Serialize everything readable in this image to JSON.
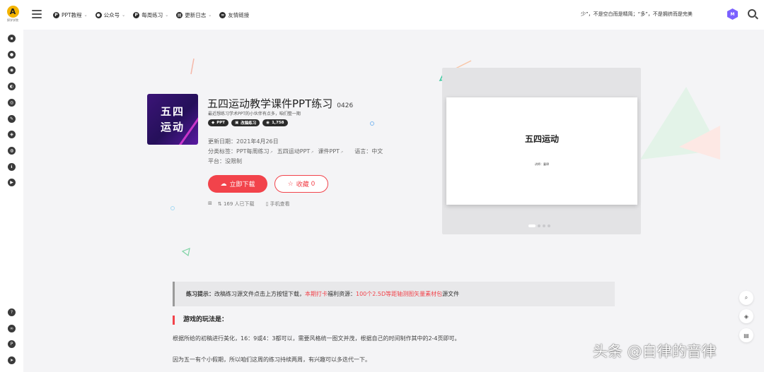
{
  "header": {
    "logo_mark": "A",
    "logo_text": "探学学院",
    "nav": [
      {
        "label": "PPT教程",
        "icon": "P",
        "icon_name": "ppt-icon",
        "has_caret": true
      },
      {
        "label": "公众号",
        "icon": "●",
        "icon_name": "wechat-icon",
        "has_caret": true
      },
      {
        "label": "每周练习",
        "icon": "P",
        "icon_name": "practice-icon",
        "has_caret": true
      },
      {
        "label": "更新日志",
        "icon": "▤",
        "icon_name": "log-icon",
        "has_caret": true
      },
      {
        "label": "友情链接",
        "icon": "∞",
        "icon_name": "link-icon",
        "has_caret": false
      }
    ],
    "caret": "⌄",
    "motto": "少”，不是空白而是精简；“多”，不是拥挤而是完美",
    "hex_icon": "M"
  },
  "sidebar": {
    "top_icons": [
      "chat-icon",
      "user-icon",
      "compass-icon",
      "globe-icon",
      "record-icon",
      "wrench-icon",
      "shield-icon",
      "palette-icon",
      "info-icon",
      "video-icon"
    ],
    "bottom_icons": [
      "help-icon",
      "link-icon",
      "p-icon",
      "send-icon"
    ]
  },
  "product": {
    "cover_line1": "五四",
    "cover_line2": "运动",
    "title": "五四运动教学课件PPT练习",
    "number": "0426",
    "subtitle": "最近想练习学术PPT的小伙伴有点多，咱们整一期",
    "badges": [
      {
        "icon": "◆",
        "label": "PPT"
      },
      {
        "icon": "▣",
        "label": "改稿练习"
      },
      {
        "icon": "◉",
        "label": "1,758"
      }
    ],
    "update_label": "更新日期：",
    "update_date": "2021年4月26日",
    "category_label": "分类标签：",
    "categories": [
      "PPT每周练习",
      "五四运动PPT",
      "课件PPT"
    ],
    "language_label": "语言：",
    "language": "中文",
    "platform_label": "平台：",
    "platform": "没限制",
    "download_label": "立即下载",
    "favorite_label": "收藏",
    "favorite_count": "0",
    "stat_share": "⊞",
    "stat_downloads": "169 人已下载",
    "stat_mobile": "手机查看"
  },
  "preview": {
    "slide_title": "五四运动",
    "slide_sub": "讲师：童律",
    "dots": 4,
    "active_dot": 0
  },
  "content": {
    "tip_prefix": "练习提示：",
    "tip_text": "改稿练习源文件点击上方按钮下载，",
    "tip_red1": "本期打卡",
    "tip_mid": "福利资源：",
    "tip_red2": "100个2.5D等距轴测图矢量素材包",
    "tip_suffix": "源文件",
    "heading": "游戏的玩法是：",
    "para1": "根据所给的初稿进行美化，16：9或4：3都可以，需要风格统一图文并茂，根据自己的时间制作其中的2-4页即可。",
    "para2": "因为五一有个小假期，所以咱们这周的练习持续两周，有兴趣可以多迭代一下。"
  },
  "watermark": "头条 @自律的音律",
  "colors": {
    "accent": "#f2434b",
    "cover": "#3b1477",
    "hex_icon": "#7b61ff"
  }
}
